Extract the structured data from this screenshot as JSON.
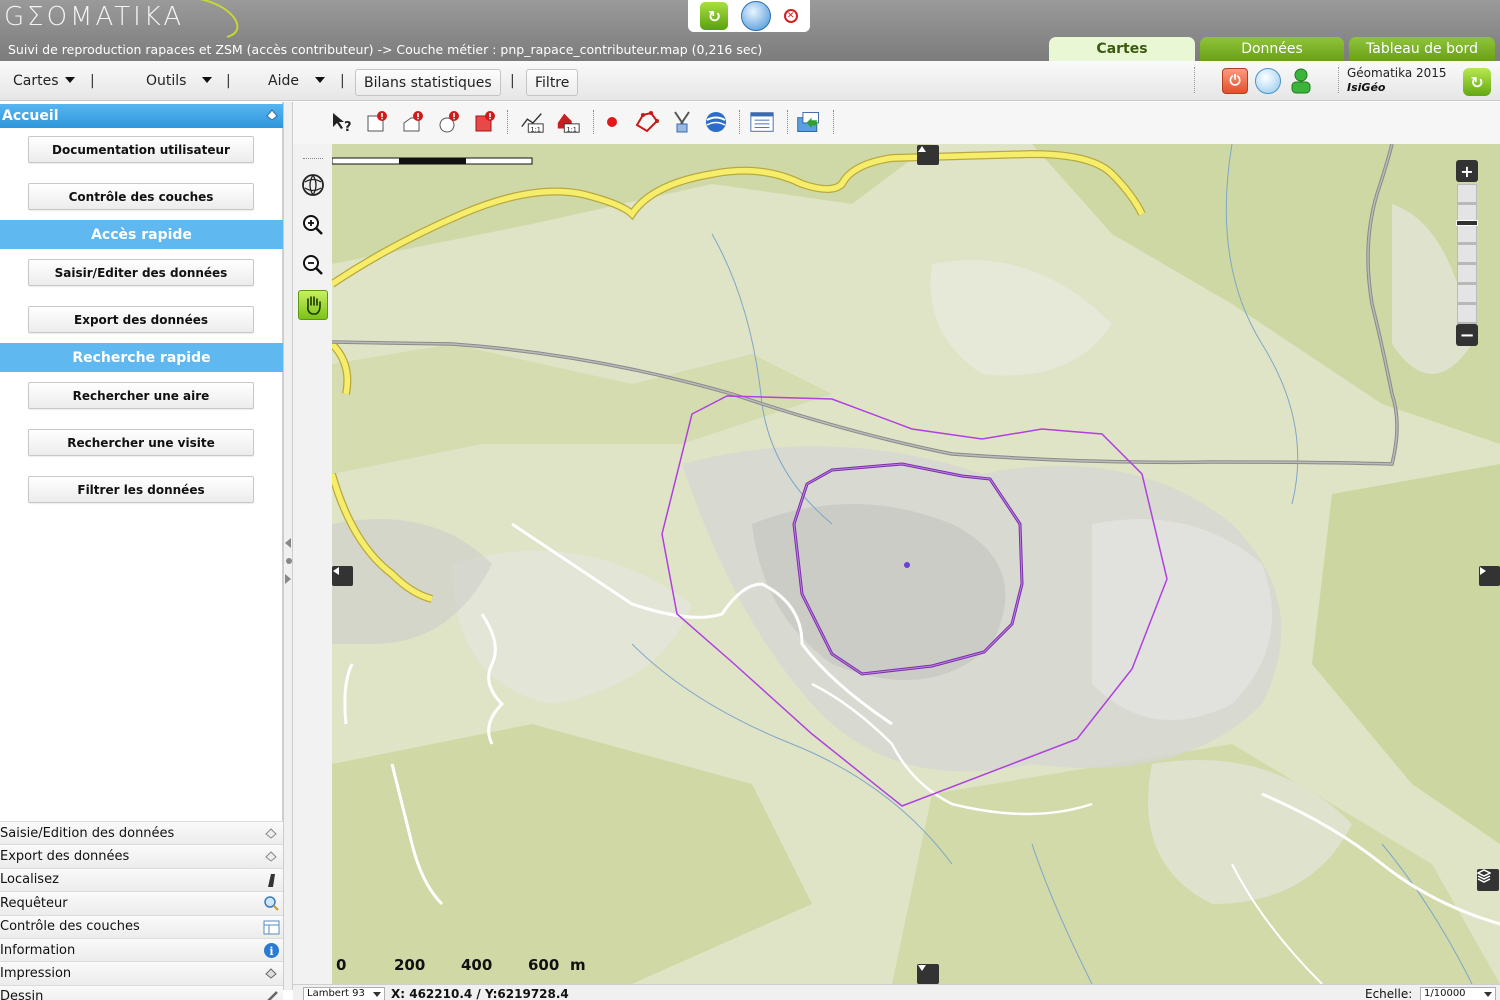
{
  "header": {
    "logo_text": "GΣOMATIKA",
    "subtitle": "Suivi de reproduction rapaces et ZSM (accès contributeur) -> Couche métier : pnp_rapace_contributeur.map (0,216 sec)",
    "tabs": [
      {
        "label": "Cartes",
        "active": true
      },
      {
        "label": "Données",
        "active": false
      },
      {
        "label": "Tableau de bord",
        "active": false
      }
    ]
  },
  "menubar": {
    "cartes": "Cartes",
    "outils": "Outils",
    "aide": "Aide",
    "bilans": "Bilans statistiques",
    "filtre": "Filtre",
    "sep": "|",
    "brand_name": "Géomatika 2015",
    "brand_sub": "IsiGéo"
  },
  "leftpanel": {
    "accueil": "Accueil",
    "buttons_top": [
      "Documentation utilisateur",
      "Contrôle des couches"
    ],
    "section_acces": "Accès rapide",
    "buttons_acces": [
      "Saisir/Editer des données",
      "Export des données"
    ],
    "section_recherche": "Recherche rapide",
    "buttons_recherche": [
      "Rechercher une aire",
      "Rechercher une visite",
      "Filtrer les données"
    ],
    "accordion": [
      "Saisie/Edition des données",
      "Export des données",
      "Localisez",
      "Requêteur",
      "Contrôle des couches",
      "Information",
      "Impression",
      "Dessin"
    ]
  },
  "map": {
    "scale_labels": [
      "0",
      "200",
      "400",
      "600",
      "m"
    ]
  },
  "status": {
    "projection": "Lambert 93",
    "coords": "X: 462210.4 / Y:6219728.4",
    "scale_label": "Echelle:",
    "scale_value": "1/10000"
  },
  "colors": {
    "header_gray": "#8a8a8a",
    "tab_green": "#7cb228",
    "panel_blue": "#5fb8f0",
    "map_bg": "#e4e8d0",
    "polygon_purple": "#a040d8"
  }
}
